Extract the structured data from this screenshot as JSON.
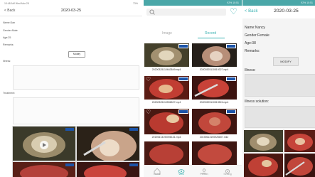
{
  "tablet": {
    "status_time": "10:48 AM  Wed Mar 25",
    "status_right": "73%",
    "back_label": "< Back",
    "date_title": "2020-03-25",
    "fields": [
      "Name:Dan",
      "Gender:Male",
      "Age:25",
      "Remarks:"
    ],
    "modify_label": "Modify",
    "illness_label": "Illness:",
    "solution_label": "Treatment:"
  },
  "video_list": {
    "status_left": "",
    "status_right": "92%  10:51",
    "tabs": [
      "Image",
      "Record"
    ],
    "active_tab": "Record",
    "videos": [
      "20200325110643549.mp4",
      "20200325110519327.mp4",
      "20200325110536527.mp4",
      "20200325110519524.mp4",
      "20190613190098131.mp4",
      "20190613190925807.mkv"
    ],
    "nav": [
      "Home",
      "View",
      "Person",
      "Setting"
    ],
    "accent_color": "#3db2b2"
  },
  "detail": {
    "status_right": "92%  10:51",
    "back_label": "< Back",
    "date_title": "2020-03-25",
    "name": "Name:Nancy",
    "gender": "Gender:Female",
    "age": "Age:38",
    "remarks": "Remarks:",
    "modify_label": "MODIFY",
    "illness_label": "Illness:",
    "solution_label": "Illness solution:"
  }
}
